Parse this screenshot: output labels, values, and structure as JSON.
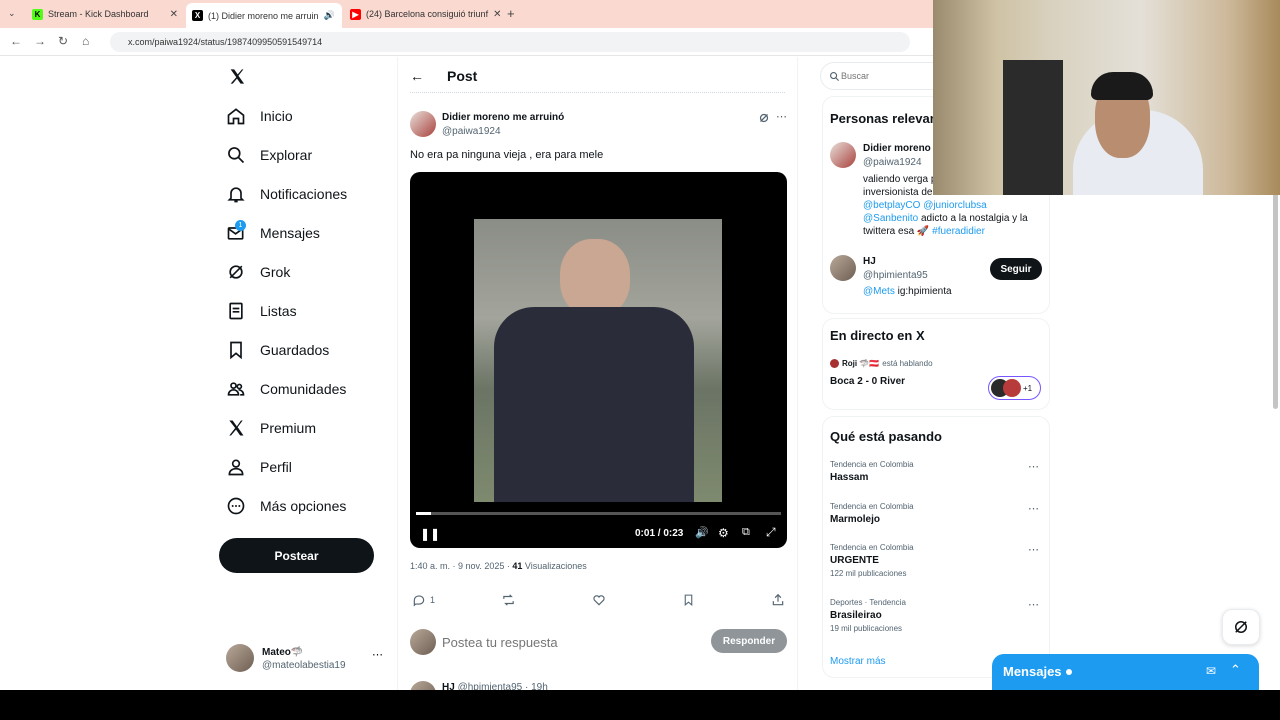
{
  "browser": {
    "tabs": [
      {
        "title": "Stream - Kick Dashboard",
        "icon": "kick-icon"
      },
      {
        "title": "(1) Didier moreno me arruin",
        "icon": "x-icon"
      },
      {
        "title": "(24) Barcelona consiguió triunf",
        "icon": "youtube-icon"
      }
    ],
    "url": "x.com/paiwa1924/status/1987409950591549714"
  },
  "nav": {
    "items": [
      {
        "label": "Inicio",
        "icon": "home-icon"
      },
      {
        "label": "Explorar",
        "icon": "search-icon"
      },
      {
        "label": "Notificaciones",
        "icon": "bell-icon"
      },
      {
        "label": "Mensajes",
        "icon": "mail-icon",
        "badge": "1"
      },
      {
        "label": "Grok",
        "icon": "grok-icon"
      },
      {
        "label": "Listas",
        "icon": "list-icon"
      },
      {
        "label": "Guardados",
        "icon": "bookmark-icon"
      },
      {
        "label": "Comunidades",
        "icon": "people-icon"
      },
      {
        "label": "Premium",
        "icon": "x-icon"
      },
      {
        "label": "Perfil",
        "icon": "person-icon"
      },
      {
        "label": "Más opciones",
        "icon": "more-circle-icon"
      }
    ],
    "post_button": "Postear",
    "account": {
      "name": "Mateo🦈",
      "handle": "@mateolabestia19"
    }
  },
  "main": {
    "header": "Post",
    "post": {
      "author": "Didier moreno me arruinó",
      "handle": "@paiwa1924",
      "text": "No era pa ninguna vieja , era para mele",
      "video": {
        "time": "0:01 / 0:23",
        "progress": 0.04
      },
      "meta_time": "1:40 a. m. · 9 nov. 2025 · ",
      "views_count": "41",
      "views_label": " Visualizaciones",
      "reply_count": "1"
    },
    "reply_box": {
      "placeholder": "Postea tu respuesta",
      "button": "Responder"
    },
    "next_reply": {
      "name": "HJ",
      "handle": "@hpimienta95 · 19h"
    }
  },
  "right": {
    "search_placeholder": "Buscar",
    "relevant": {
      "title": "Personas relevantes",
      "people": [
        {
          "name": "Didier moreno",
          "handle": "@paiwa1924",
          "bio1": "valiendo verga p",
          "bio2": "inversionista de",
          "bio_link1": "@betplayCO",
          "bio_link2": "@juniorclubsa",
          "bio_link3": "@Sanbenito",
          "bio_text3": " adicto a la nostalgia y la",
          "bio_text4": "twittera esa 🚀 ",
          "bio_link4": "#fueradidier"
        },
        {
          "name": "HJ",
          "handle": "@hpimienta95",
          "bio_link": "@Mets",
          "bio_text": " ig:hpimienta",
          "button": "Seguir"
        }
      ]
    },
    "live": {
      "title": "En directo en X",
      "host": "Roji 🦈🇦🇹",
      "status": "está hablando",
      "space": "Boca 2 - 0 River",
      "extra": "+1"
    },
    "trends": {
      "title": "Qué está pasando",
      "items": [
        {
          "meta": "Tendencia en Colombia",
          "name": "Hassam",
          "count": ""
        },
        {
          "meta": "Tendencia en Colombia",
          "name": "Marmolejo",
          "count": ""
        },
        {
          "meta": "Tendencia en Colombia",
          "name": "URGENTE",
          "count": "122 mil publicaciones"
        },
        {
          "meta": "Deportes · Tendencia",
          "name": "Brasileirao",
          "count": "19 mil publicaciones"
        }
      ],
      "show_more": "Mostrar más"
    },
    "messages_drawer": "Mensajes"
  },
  "colors": {
    "accent": "#1d9bf0",
    "tabbar": "#f9d9d0",
    "text": "#0f1419",
    "muted": "#536471"
  }
}
